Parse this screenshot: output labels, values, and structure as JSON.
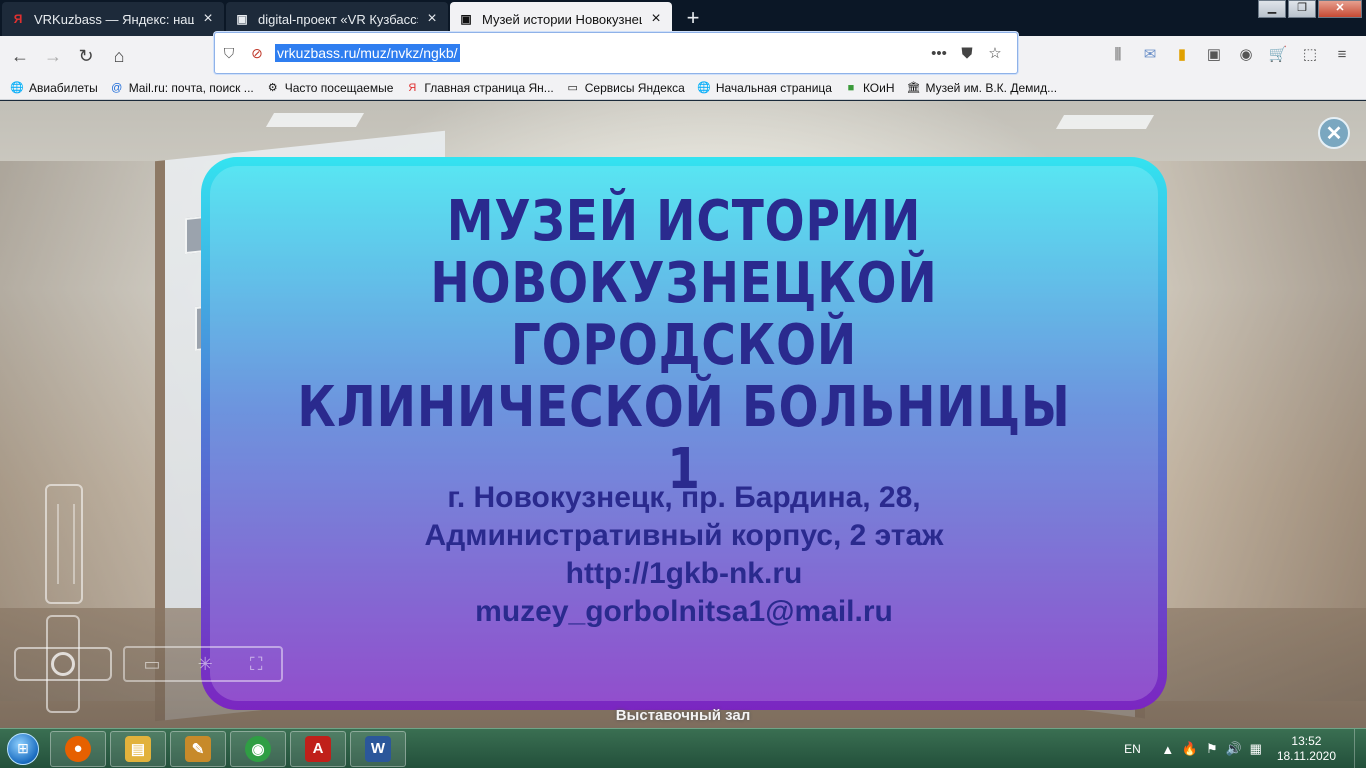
{
  "browser": {
    "tabs": [
      {
        "favicon": "Я",
        "title": "VRKuzbass — Яндекс: нашлось",
        "active": false
      },
      {
        "favicon": "▣",
        "title": "digital-проект «VR Кузбасс» —",
        "active": false
      },
      {
        "favicon": "▣",
        "title": "Музей истории Новокузнецк",
        "active": true
      }
    ],
    "new_tab_label": "+",
    "url": "vrkuzbass.ru/muz/nvkz/ngkb/",
    "bookmarks": [
      {
        "icon": "globe-icon",
        "label": "Авиабилеты"
      },
      {
        "icon": "mail-icon",
        "label": "Mail.ru: почта, поиск ..."
      },
      {
        "icon": "gear-icon",
        "label": "Часто посещаемые"
      },
      {
        "icon": "yandex-icon",
        "label": "Главная страница Ян..."
      },
      {
        "icon": "folder-icon",
        "label": "Сервисы Яндекса"
      },
      {
        "icon": "globe-icon",
        "label": "Начальная страница"
      },
      {
        "icon": "koin-icon",
        "label": "КОиН"
      },
      {
        "icon": "museum-icon",
        "label": "Музей им. В.К. Демид..."
      }
    ]
  },
  "tour": {
    "title_lines": [
      "МУЗЕЙ ИСТОРИИ",
      "НОВОКУЗНЕЦКОЙ ГОРОДСКОЙ",
      "КЛИНИЧЕСКОЙ БОЛЬНИЦЫ 1"
    ],
    "address_lines": [
      "г. Новокузнецк, пр. Бардина, 28,",
      "Административный корпус, 2 этаж",
      "http://1gkb-nk.ru",
      "muzey_gorbolnitsa1@mail.ru"
    ],
    "scene_label": "Выставочный зал",
    "colors": {
      "title_text": "#2a2a8e",
      "frame_top": "#33e3f0",
      "frame_bottom": "#7b26c1"
    }
  },
  "taskbar": {
    "apps": [
      {
        "name": "firefox",
        "glyph": "●",
        "color": "#e66000"
      },
      {
        "name": "explorer",
        "glyph": "▤",
        "color": "#e2b23c"
      },
      {
        "name": "tool",
        "glyph": "✎",
        "color": "#c78a2a"
      },
      {
        "name": "chrome",
        "glyph": "◉",
        "color": "#2f9e44"
      },
      {
        "name": "acrobat",
        "glyph": "A",
        "color": "#c0201a"
      },
      {
        "name": "word",
        "glyph": "W",
        "color": "#2b579a"
      }
    ],
    "lang": "EN",
    "time": "13:52",
    "date": "18.11.2020"
  }
}
